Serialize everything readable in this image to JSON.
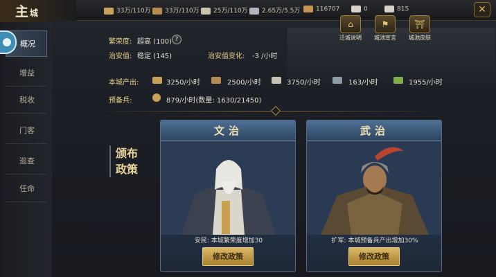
{
  "title": {
    "main": "主",
    "sub": "城"
  },
  "resources": [
    {
      "icon": "grain-icon",
      "text": "33万/110万",
      "color": "#c9a15a"
    },
    {
      "icon": "wood-icon",
      "text": "33万/110万",
      "color": "#b58b52"
    },
    {
      "icon": "stone-icon",
      "text": "25万/110万",
      "color": "#c7c2b2"
    },
    {
      "icon": "iron-icon",
      "text": "2.65万/5.5万",
      "color": "#b0b4b8"
    },
    {
      "icon": "copper-coin-icon",
      "text": "116707",
      "color": "#c49550"
    },
    {
      "icon": "gold-ingot-icon",
      "text": "0",
      "color": "#d8d3c6"
    },
    {
      "icon": "silver-ingot-icon",
      "text": "815",
      "color": "#d8d3c6"
    }
  ],
  "sidebar": {
    "items": [
      {
        "label": "概况",
        "active": true
      },
      {
        "label": "增益"
      },
      {
        "label": "税收"
      },
      {
        "label": "门客"
      },
      {
        "label": "巡查"
      },
      {
        "label": "任命"
      }
    ]
  },
  "stats": {
    "prosperity_label": "繁荣度:",
    "prosperity_value": "超高 (100)",
    "security_label": "治安值:",
    "security_value": "稳定 (145)",
    "security_change_label": "治安值变化:",
    "security_change_value": "-3 /小时",
    "output_label": "本城产出:",
    "outputs": [
      {
        "icon": "grain-icon",
        "text": "3250/小时",
        "color": "#c9a15a"
      },
      {
        "icon": "wood-icon",
        "text": "2500/小时",
        "color": "#b58b52"
      },
      {
        "icon": "stone-icon",
        "text": "3750/小时",
        "color": "#c7c2b2"
      },
      {
        "icon": "iron-icon",
        "text": "163/小时",
        "color": "#8e9aa4"
      },
      {
        "icon": "jade-icon",
        "text": "1955/小时",
        "color": "#7fae4a"
      }
    ],
    "reserve_label": "预备兵:",
    "reserve_value": "879/小时(数量: 1630/21450)"
  },
  "buildings": [
    {
      "label": "迁城说明",
      "icon": "pagoda-icon"
    },
    {
      "label": "城池宣言",
      "icon": "banner-icon"
    },
    {
      "label": "城池皮肤",
      "icon": "palace-icon"
    }
  ],
  "policy": {
    "title_chars": "颁布政策",
    "cards": [
      {
        "title": "文治",
        "desc": "安民: 本城繁荣度增加30",
        "button": "修改政策",
        "accent": "#9ea9b6"
      },
      {
        "title": "武治",
        "desc": "扩军: 本城预备兵产出增加30%",
        "button": "修改政策",
        "accent": "#b8452f"
      }
    ]
  }
}
